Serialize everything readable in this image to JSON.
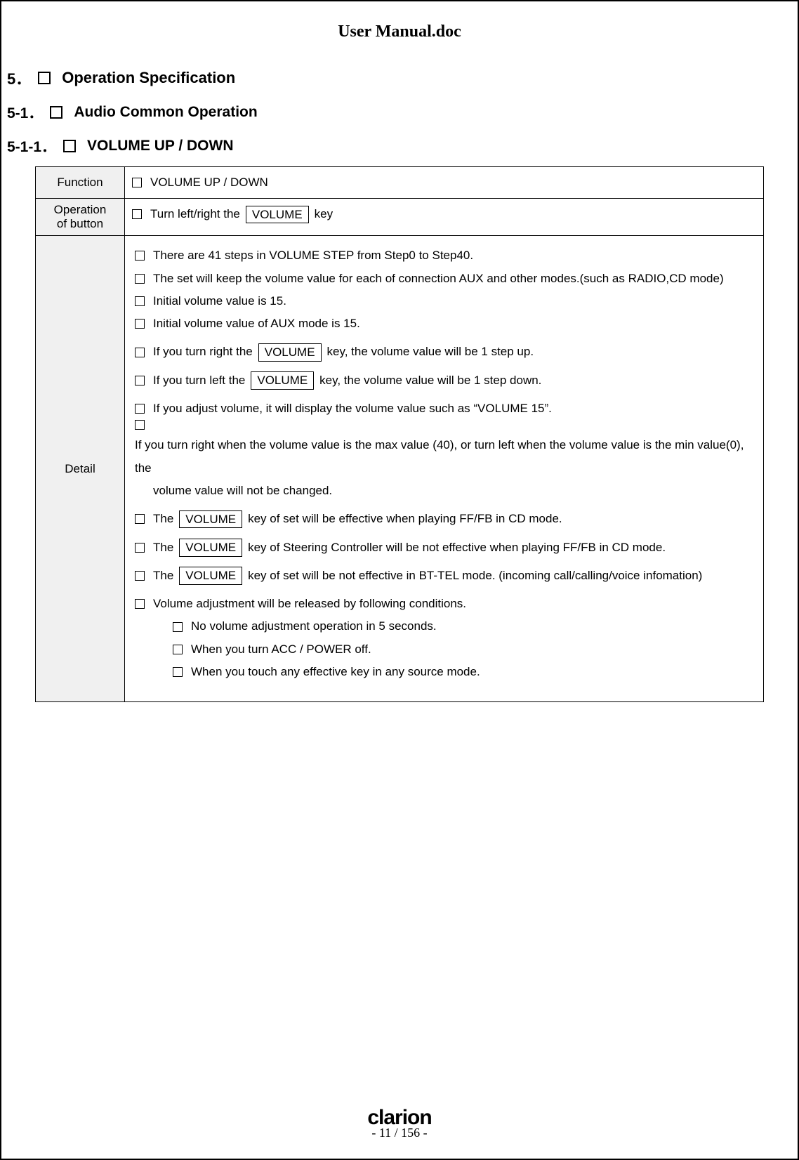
{
  "doc_title": "User Manual.doc",
  "h5_num": "5．",
  "h5_text": "Operation Specification",
  "h51_num": "5-1．",
  "h51_text": "Audio Common Operation",
  "h511_num": "5-1-1．",
  "h511_text": "VOLUME UP / DOWN",
  "row_function_label": "Function",
  "row_function_value": "VOLUME UP / DOWN",
  "row_operation_label1": "Operation",
  "row_operation_label2": "of button",
  "op_pre": "Turn left/right the",
  "op_key": "VOLUME",
  "op_post": "key",
  "row_detail_label": "Detail",
  "d1": "There are 41 steps in VOLUME  STEP from Step0 to Step40.",
  "d2": "The set will keep the volume value for each of connection AUX and other modes.(such as RADIO,CD mode)",
  "d3": "Initial volume value is 15.",
  "d4": "Initial volume value of AUX mode is 15.",
  "d5_pre": "If you turn right the",
  "d5_key": "VOLUME",
  "d5_post": "key, the volume value will be 1 step up.",
  "d6_pre": "If you turn left the",
  "d6_key": "VOLUME",
  "d6_post": "key, the volume value will be 1 step down.",
  "d7": "If you adjust volume, it will display the volume value such as “VOLUME  15”.",
  "d8a": "If you turn right when the volume value is the max value (40), or turn left when the volume value is the min value(0), the",
  "d8b": "volume value will not be changed.",
  "d9_pre": "The",
  "d9_key": "VOLUME",
  "d9_post": "key of set will be effective when playing FF/FB in CD mode.",
  "d10_pre": "The",
  "d10_key": "VOLUME",
  "d10_post": "key of Steering Controller will be not effective when playing FF/FB in CD mode.",
  "d11_pre": "The",
  "d11_key": "VOLUME",
  "d11_post": "key of set will be not effective in BT-TEL mode. (incoming call/calling/voice infomation)",
  "d12": "Volume adjustment will be released by following conditions.",
  "d12a": "No volume adjustment operation in 5 seconds.",
  "d12b": "When you turn ACC / POWER  off.",
  "d12c": "When you touch any effective key in any source mode.",
  "logo_text": "clarion",
  "page_indicator": "- 11 / 156 -"
}
